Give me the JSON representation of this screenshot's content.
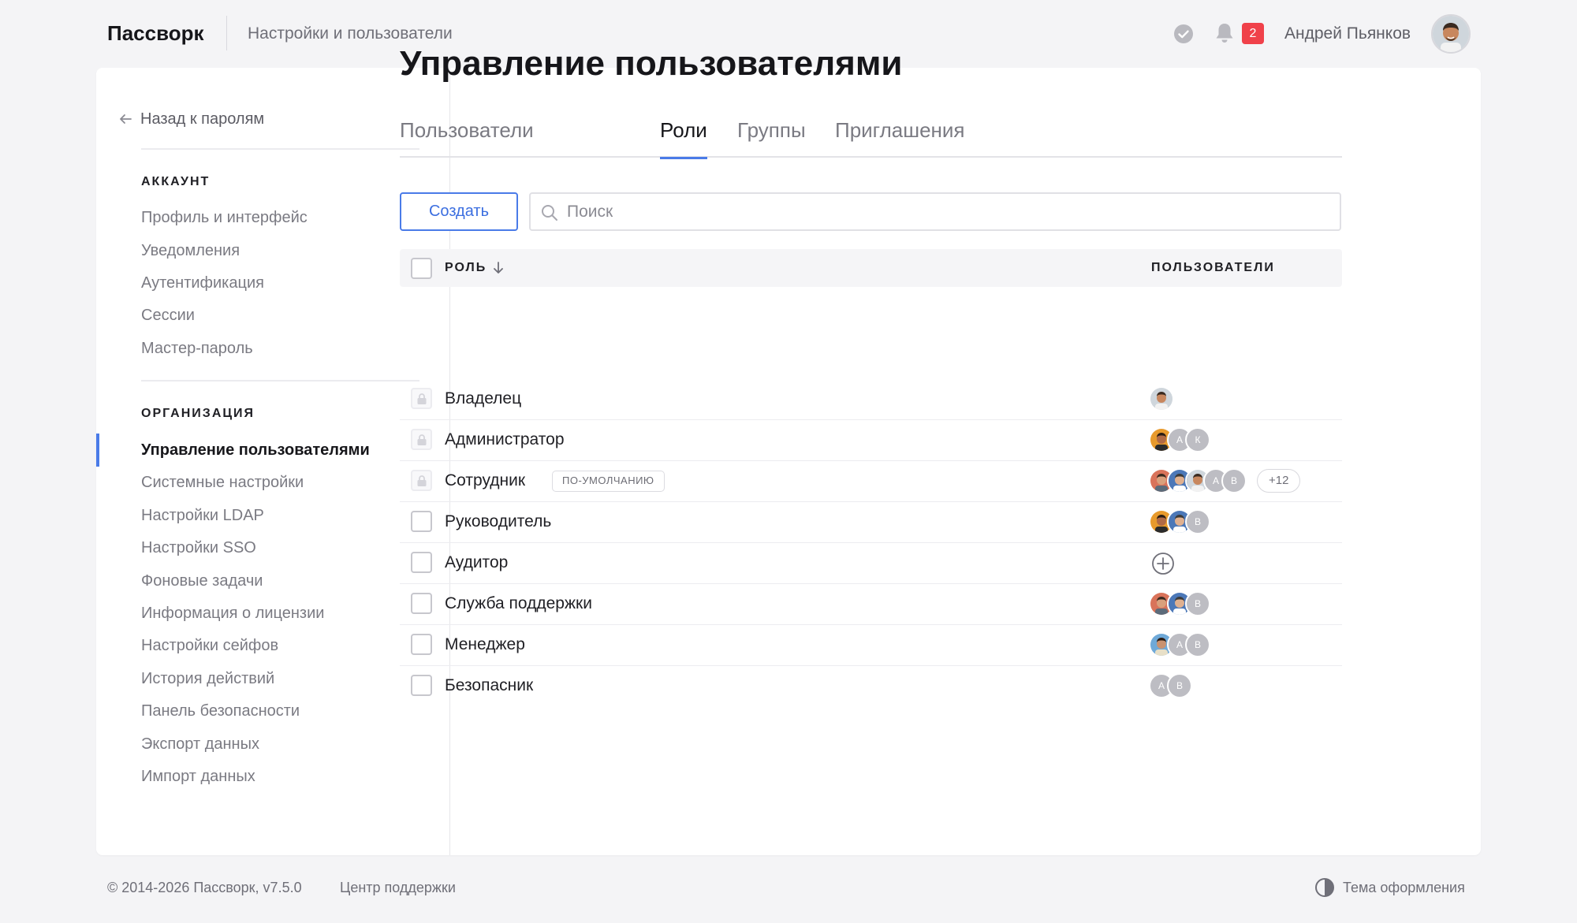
{
  "header": {
    "brand": "Пассворк",
    "crumb": "Настройки и пользователи",
    "notifications_count": "2",
    "user_name": "Андрей Пьянков"
  },
  "sidebar": {
    "back_label": "Назад к паролям",
    "sections": [
      {
        "title": "АККАУНТ",
        "items": [
          "Профиль и интерфейс",
          "Уведомления",
          "Аутентификация",
          "Сессии",
          "Мастер-пароль"
        ]
      },
      {
        "title": "ОРГАНИЗАЦИЯ",
        "items": [
          "Управление пользователями",
          "Системные настройки",
          "Настройки LDAP",
          "Настройки SSO",
          "Фоновые задачи",
          "Информация о лицензии",
          "Настройки сейфов",
          "История действий",
          "Панель безопасности",
          "Экспорт данных",
          "Импорт данных"
        ]
      }
    ],
    "active_item": "Управление пользователями"
  },
  "main": {
    "title": "Управление пользователями",
    "tabs": [
      {
        "label": "Пользователи",
        "active": false
      },
      {
        "label": "Роли",
        "active": true
      },
      {
        "label": "Группы",
        "active": false
      },
      {
        "label": "Приглашения",
        "active": false
      }
    ],
    "create_label": "Создать",
    "search_placeholder": "Поиск",
    "table": {
      "col_role": "РОЛЬ",
      "col_users": "ПОЛЬЗОВАТЕЛИ",
      "rows": [
        {
          "name": "Владелец",
          "locked": true,
          "badge": "",
          "avatars": [
            "photo-1"
          ],
          "more": ""
        },
        {
          "name": "Администратор",
          "locked": true,
          "badge": "",
          "avatars": [
            "photo-2",
            "А",
            "К"
          ],
          "more": ""
        },
        {
          "name": "Сотрудник",
          "locked": true,
          "badge": "ПО-УМОЛЧАНИЮ",
          "avatars": [
            "photo-3",
            "photo-4",
            "photo-1",
            "А",
            "В"
          ],
          "more": "+12"
        },
        {
          "name": "Руководитель",
          "locked": false,
          "badge": "",
          "avatars": [
            "photo-2",
            "photo-4",
            "В"
          ],
          "more": ""
        },
        {
          "name": "Аудитор",
          "locked": false,
          "badge": "",
          "avatars": [],
          "more": ""
        },
        {
          "name": "Служба поддержки",
          "locked": false,
          "badge": "",
          "avatars": [
            "photo-3",
            "photo-4",
            "В"
          ],
          "more": ""
        },
        {
          "name": "Менеджер",
          "locked": false,
          "badge": "",
          "avatars": [
            "photo-5",
            "А",
            "В"
          ],
          "more": ""
        },
        {
          "name": "Безопасник",
          "locked": false,
          "badge": "",
          "avatars": [
            "А",
            "В"
          ],
          "more": ""
        }
      ]
    }
  },
  "footer": {
    "copyright": "© 2014-2026 Пассворк, v7.5.0",
    "support": "Центр поддержки",
    "theme": "Тема оформления"
  },
  "colors": {
    "accent": "#4a7be8",
    "badge_red": "#f0414a",
    "letter_avatar": "#bdbdc3"
  },
  "icons": [
    "status-check-icon",
    "bell-icon",
    "arrow-left-icon",
    "search-icon",
    "sort-down-icon",
    "lock-icon",
    "add-circle-icon",
    "theme-contrast-icon"
  ]
}
